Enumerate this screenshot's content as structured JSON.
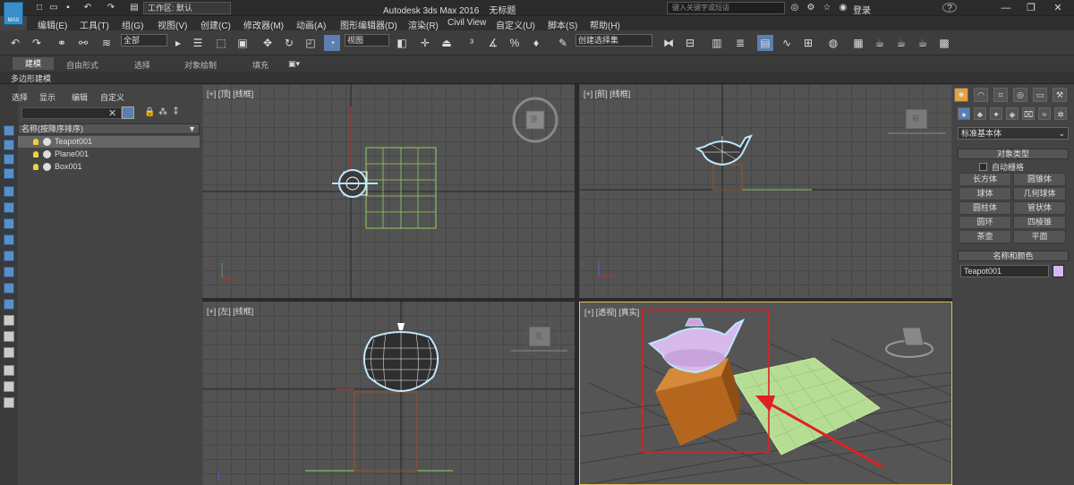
{
  "titlebar": {
    "logo_text": "MAX",
    "workspace": "工作区: 默认",
    "app_title": "Autodesk 3ds Max 2016",
    "doc_title": "无标题",
    "search_placeholder": "键入关键字或短语",
    "login": "登录",
    "help": "?"
  },
  "menu": [
    "编辑(E)",
    "工具(T)",
    "组(G)",
    "视图(V)",
    "创建(C)",
    "修改器(M)",
    "动画(A)",
    "图形编辑器(D)",
    "渲染(R)",
    "Civil View",
    "自定义(U)",
    "脚本(S)",
    "帮助(H)"
  ],
  "toolbar": {
    "selection_filter": "全部",
    "ref_coord": "视图",
    "named_selection": "创建选择集"
  },
  "ribbon": {
    "tabs": [
      "建模",
      "自由形式",
      "选择",
      "对象绘制",
      "填充"
    ],
    "panel": "多边形建模"
  },
  "scene_explorer": {
    "tabs": [
      "选择",
      "显示",
      "编辑",
      "自定义"
    ],
    "column_header": "名称(按降序排序)",
    "items": [
      {
        "name": "Teapot001",
        "selected": true
      },
      {
        "name": "Plane001",
        "selected": false
      },
      {
        "name": "Box001",
        "selected": false
      }
    ]
  },
  "viewports": {
    "top": "[+] [顶] [线框]",
    "front": "[+] [前] [线框]",
    "left": "[+] [左] [线框]",
    "persp": "[+] [透视] [真实]",
    "viewcube_top": "顶",
    "viewcube_front": "前",
    "viewcube_left": "左"
  },
  "command_panel": {
    "dropdown": "标准基本体",
    "object_type_header": "对象类型",
    "autogrid": "自动栅格",
    "buttons": [
      "长方体",
      "圆锥体",
      "球体",
      "几何球体",
      "圆柱体",
      "管状体",
      "圆环",
      "四棱锥",
      "茶壶",
      "平面"
    ],
    "name_color_header": "名称和颜色",
    "object_name": "Teapot001",
    "object_color": "#d7b7f0"
  },
  "annotation": {
    "highlight_color": "#e02020",
    "arrow_color": "#e02020"
  }
}
